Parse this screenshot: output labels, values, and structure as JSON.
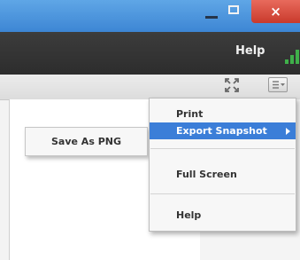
{
  "window": {
    "close_symbol": "×",
    "icons": [
      "minimize-icon",
      "maximize-icon",
      "close-icon"
    ]
  },
  "menubar": {
    "help_label": "Help",
    "signal_icon": "signal-bars-icon"
  },
  "toolbar": {
    "icons": [
      "fullscreen-icon",
      "menu-icon"
    ]
  },
  "submenu": {
    "items": [
      {
        "label": "Save As PNG"
      }
    ]
  },
  "dropdown": {
    "items": [
      {
        "label": "Print"
      },
      {
        "label": "Export Snapshot",
        "highlighted": true,
        "has_submenu": true
      },
      {
        "label": "Full Screen"
      },
      {
        "label": "Help"
      }
    ]
  },
  "colors": {
    "highlight": "#3b7ed8",
    "titlebar": "#4a93dc",
    "close": "#d9493a",
    "menubar": "#333333"
  }
}
